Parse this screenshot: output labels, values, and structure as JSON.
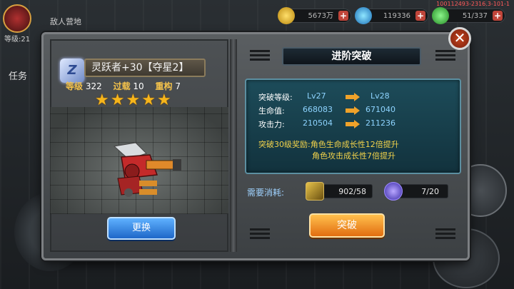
{
  "version": "100112493-2316.3-101-1",
  "background": {
    "title": "敌人营地",
    "level_label": "等级:21",
    "task_label": "任务",
    "resources": [
      {
        "icon": "gold-coin-icon",
        "value": "5673万"
      },
      {
        "icon": "blue-gem-icon",
        "value": "119336"
      },
      {
        "icon": "green-energy-icon",
        "value": "51/337"
      }
    ]
  },
  "hero": {
    "badge": "Z",
    "name": "灵跃者+30【夺星2】",
    "stats": [
      {
        "label": "等级",
        "value": "322"
      },
      {
        "label": "过载",
        "value": "10"
      },
      {
        "label": "重构",
        "value": "7"
      }
    ],
    "stars": 5,
    "change_label": "更换"
  },
  "panel": {
    "title": "进阶突破",
    "rows": [
      {
        "label": "突破等级:",
        "old": "Lv27",
        "new": "Lv28"
      },
      {
        "label": "生命值:",
        "old": "668083",
        "new": "671040"
      },
      {
        "label": "攻击力:",
        "old": "210504",
        "new": "211236"
      }
    ],
    "reward_prefix": "突破30级奖励:",
    "reward_lines": [
      "角色生命成长性12倍提升",
      "角色攻击成长性7倍提升"
    ],
    "cost_label": "需要消耗:",
    "costs": [
      {
        "icon": "upgrade-material-icon",
        "value": "902/58"
      },
      {
        "icon": "blue-orb-icon",
        "value": "7/20"
      }
    ],
    "break_label": "突破"
  },
  "colors": {
    "accent_gold": "#f2c14b",
    "value_blue": "#8ed4ff",
    "arrow_orange": "#f0a22a",
    "reward_yellow": "#f2d34b"
  }
}
